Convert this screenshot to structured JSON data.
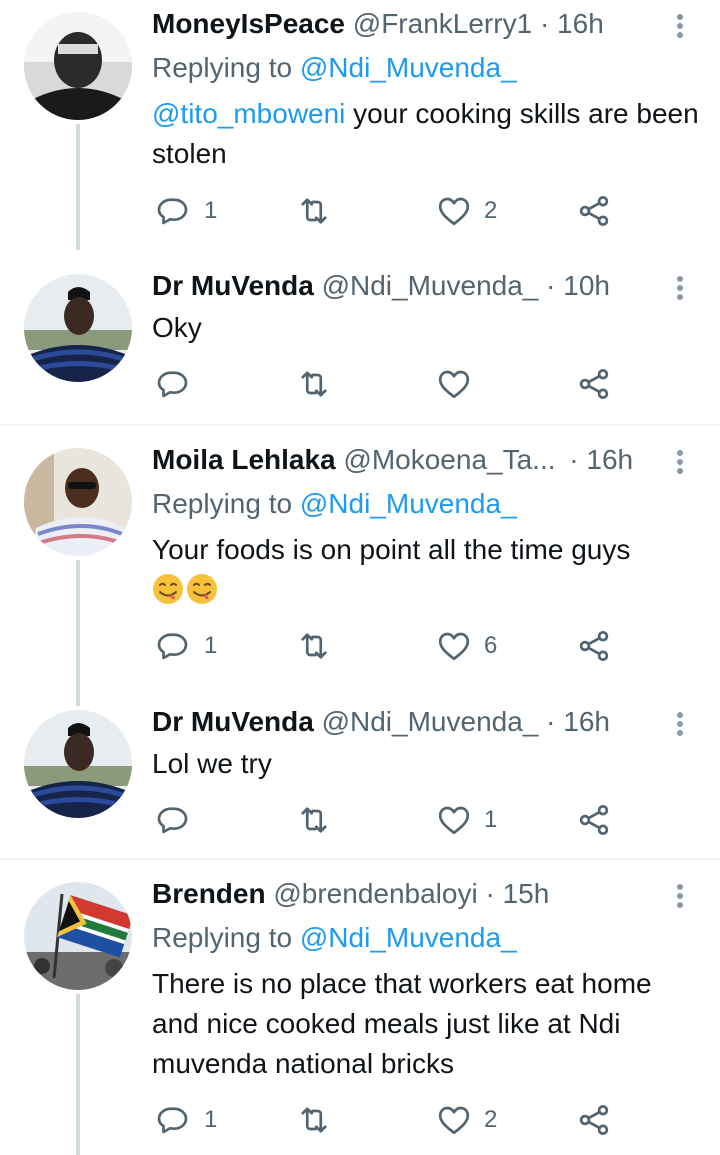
{
  "tweets": [
    {
      "name": "MoneyIsPeace",
      "handle": "@FrankLerry1",
      "sep": "·",
      "time": "16h",
      "replying_prefix": "Replying to",
      "replying_to": "@Ndi_Muvenda_",
      "mention": "@tito_mboweni",
      "text": " your cooking skills are been stolen",
      "counts": {
        "reply": "1",
        "retweet": "",
        "like": "2"
      }
    },
    {
      "name": "Dr MuVenda",
      "handle": "@Ndi_Muvenda_",
      "sep": "·",
      "time": "10h",
      "text": "Oky",
      "counts": {
        "reply": "",
        "retweet": "",
        "like": ""
      }
    },
    {
      "name": "Moila Lehlaka",
      "handle": "@Mokoena_Ta...",
      "sep": "·",
      "time": "16h",
      "replying_prefix": "Replying to",
      "replying_to": "@Ndi_Muvenda_",
      "text": "Your foods is on point all the time guys",
      "emoji": [
        "face-savoring-food",
        "face-savoring-food"
      ],
      "counts": {
        "reply": "1",
        "retweet": "",
        "like": "6"
      }
    },
    {
      "name": "Dr MuVenda",
      "handle": "@Ndi_Muvenda_",
      "sep": "·",
      "time": "16h",
      "text": "Lol we try",
      "counts": {
        "reply": "",
        "retweet": "",
        "like": "1"
      }
    },
    {
      "name": "Brenden",
      "handle": "@brendenbaloyi",
      "sep": "·",
      "time": "15h",
      "replying_prefix": "Replying to",
      "replying_to": "@Ndi_Muvenda_",
      "text": "There is no place that workers eat home and nice cooked meals just like at Ndi muvenda national bricks",
      "counts": {
        "reply": "1",
        "retweet": "",
        "like": "2"
      }
    }
  ],
  "icons": {
    "reply": "reply-icon",
    "retweet": "retweet-icon",
    "like": "heart-icon",
    "share": "share-icon",
    "more": "more-icon"
  },
  "colors": {
    "text": "#0f1419",
    "secondary": "#536471",
    "link": "#1d9bf0",
    "thread_line": "#cfd9de",
    "divider": "#eff3f4"
  }
}
